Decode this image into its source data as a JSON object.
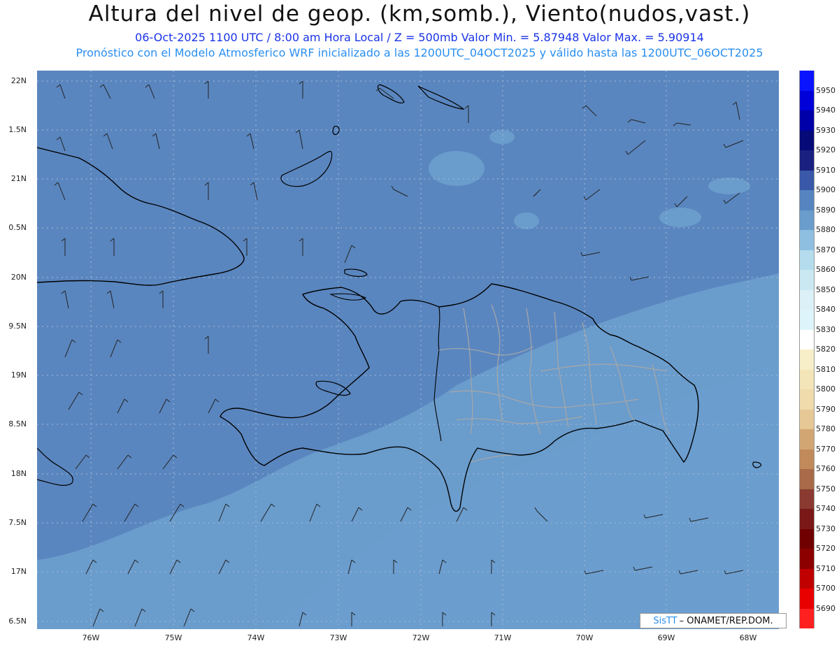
{
  "header": {
    "title": "Altura del nivel de geop. (km,somb.), Viento(nudos,vast.)",
    "subtitle": "06-Oct-2025  1100 UTC / 8:00 am Hora Local / Z = 500mb     Valor Min. = 5.87948  Valor Max. = 5.90914",
    "model_info": "Pronóstico con el Modelo Atmosferico WRF inicializado a las 1200UTC_04OCT2025 y válido hasta las  1200UTC_06OCT2025"
  },
  "axes": {
    "y_labels": [
      "22N",
      "1.5N",
      "21N",
      "0.5N",
      "20N",
      "9.5N",
      "19N",
      "8.5N",
      "18N",
      "7.5N",
      "17N",
      "6.5N"
    ],
    "x_labels": [
      "76W",
      "75W",
      "74W",
      "73W",
      "72W",
      "71W",
      "70W",
      "69W",
      "68W"
    ]
  },
  "colorbar": {
    "labels": [
      "5950",
      "5940",
      "5930",
      "5920",
      "5910",
      "5900",
      "5890",
      "5880",
      "5870",
      "5860",
      "5850",
      "5840",
      "5830",
      "5820",
      "5810",
      "5800",
      "5790",
      "5780",
      "5770",
      "5760",
      "5750",
      "5740",
      "5730",
      "5720",
      "5710",
      "5700",
      "5690"
    ],
    "colors": [
      "#0a14ff",
      "#0000d8",
      "#0000a8",
      "#050a78",
      "#1a2080",
      "#3a58a8",
      "#5584bf",
      "#6a9ccc",
      "#8ebfe0",
      "#b4dced",
      "#c9e8f2",
      "#dcf0f7",
      "#ddf5fa",
      "#ffffff",
      "#f7efc8",
      "#f3e5b8",
      "#efdbab",
      "#e6c896",
      "#d2a673",
      "#c08a5a",
      "#a86a48",
      "#8a3a30",
      "#7a1818",
      "#700000",
      "#8c0000",
      "#c00000",
      "#e80000",
      "#ff2020"
    ]
  },
  "credit": {
    "brand": "SisTT",
    "org": "– ONAMET/REP.DOM."
  },
  "colors": {
    "ocean_dark": "#5584bf",
    "ocean_light": "#6a9ccc",
    "coast": "#000000",
    "borders": "#a8a8a8"
  },
  "chart_data": {
    "type": "heatmap",
    "title": "Altura del nivel de geop. (km,somb.), Viento(nudos,vast.)",
    "level": "500mb",
    "valid_time": "06-Oct-2025 1100 UTC",
    "min_value": 5.87948,
    "max_value": 5.90914,
    "lon_range": [
      -76.6,
      -67.6
    ],
    "lat_range": [
      16.4,
      22.1
    ]
  }
}
